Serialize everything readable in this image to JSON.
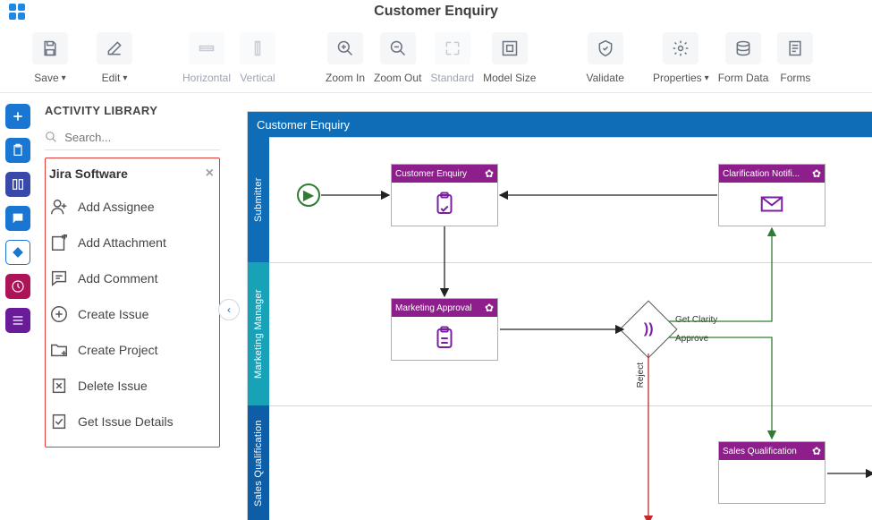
{
  "header": {
    "title": "Customer Enquiry"
  },
  "toolbar": [
    {
      "id": "save",
      "label": "Save",
      "hasChevron": true,
      "enabled": true
    },
    {
      "id": "edit",
      "label": "Edit",
      "hasChevron": true,
      "enabled": true
    },
    {
      "id": "horizontal",
      "label": "Horizontal",
      "enabled": false
    },
    {
      "id": "vertical",
      "label": "Vertical",
      "enabled": false
    },
    {
      "id": "zoom-in",
      "label": "Zoom In",
      "enabled": true
    },
    {
      "id": "zoom-out",
      "label": "Zoom Out",
      "enabled": true
    },
    {
      "id": "standard",
      "label": "Standard",
      "enabled": false
    },
    {
      "id": "model-size",
      "label": "Model Size",
      "enabled": true
    },
    {
      "id": "validate",
      "label": "Validate",
      "enabled": true
    },
    {
      "id": "properties",
      "label": "Properties",
      "hasChevron": true,
      "enabled": true
    },
    {
      "id": "form-data",
      "label": "Form Data",
      "enabled": true
    },
    {
      "id": "forms",
      "label": "Forms",
      "enabled": true
    }
  ],
  "sidebar": {
    "title": "ACTIVITY LIBRARY",
    "search_placeholder": "Search...",
    "category": "Jira Software",
    "items": [
      {
        "label": "Add Assignee"
      },
      {
        "label": "Add Attachment"
      },
      {
        "label": "Add Comment"
      },
      {
        "label": "Create Issue"
      },
      {
        "label": "Create Project"
      },
      {
        "label": "Delete Issue"
      },
      {
        "label": "Get Issue Details"
      }
    ]
  },
  "diagram": {
    "title": "Customer Enquiry",
    "lanes": [
      {
        "name": "Submitter"
      },
      {
        "name": "Marketing Manager"
      },
      {
        "name": "Sales Qualification"
      }
    ],
    "nodes": {
      "customer_enquiry": "Customer Enquiry",
      "clarification": "Clarification Notifi...",
      "marketing_approval": "Marketing Approval",
      "sales_qualification": "Sales Qualification"
    },
    "edges": {
      "get_clarity": "Get Clarity",
      "approve": "Approve",
      "reject": "Reject"
    }
  }
}
